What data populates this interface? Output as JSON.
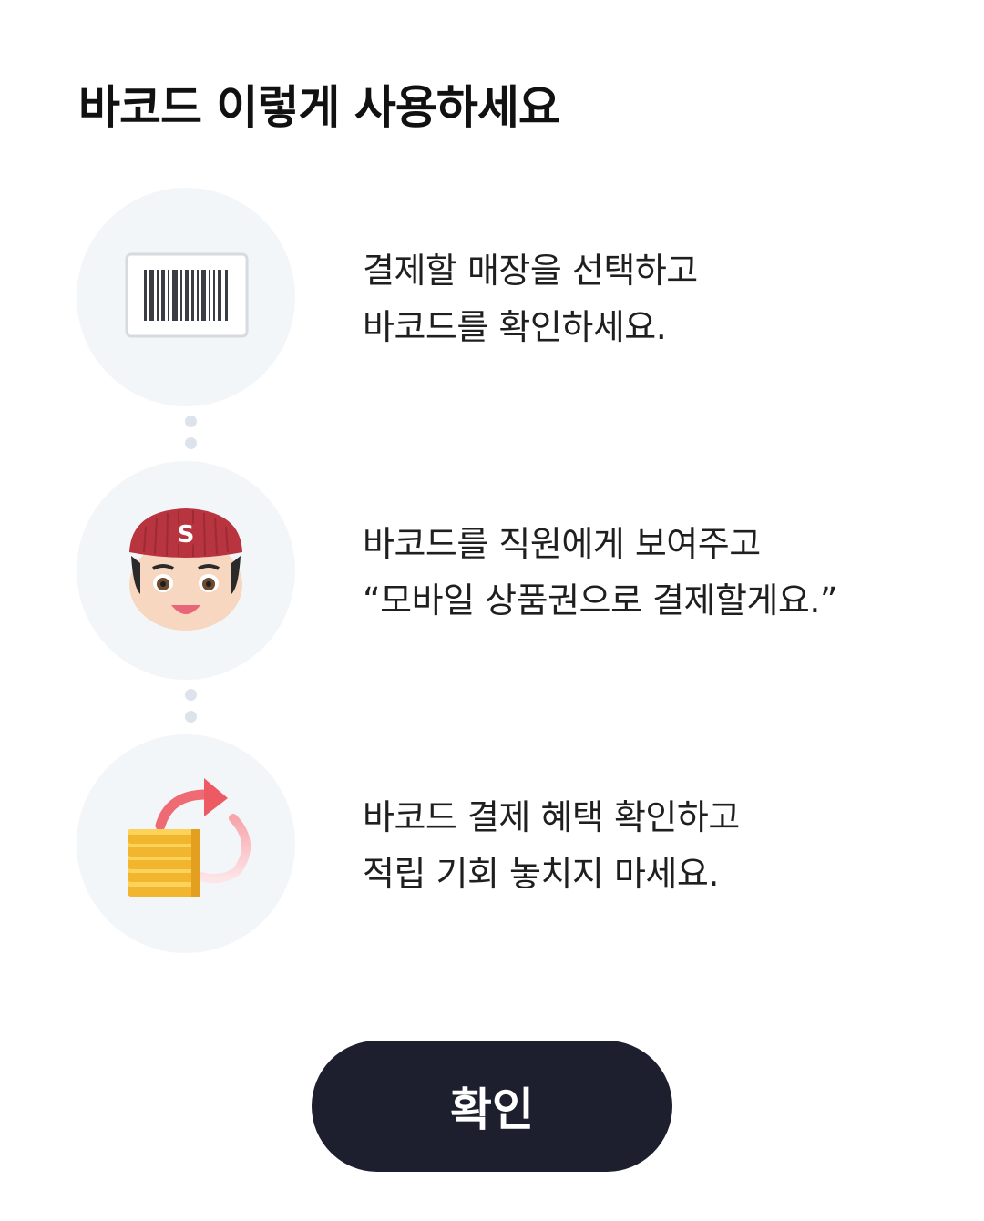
{
  "title": "바코드 이렇게 사용하세요",
  "steps": [
    {
      "icon": "barcode-icon",
      "line1": "결제할 매장을 선택하고",
      "line2": "바코드를 확인하세요."
    },
    {
      "icon": "staff-icon",
      "badge": "S",
      "line1": "바코드를 직원에게 보여주고",
      "line2": "“모바일 상품권으로 결제할게요.”"
    },
    {
      "icon": "coins-refresh-icon",
      "line1": "바코드 결제 혜택 확인하고",
      "line2": "적립 기회 놓치지 마세요."
    }
  ],
  "confirm_label": "확인",
  "colors": {
    "button_bg": "#1d1f2e",
    "circle_bg": "#f3f6f9",
    "cap_red": "#b8343f",
    "coin_yellow": "#f7c544",
    "arrow_red": "#ee5a63"
  }
}
